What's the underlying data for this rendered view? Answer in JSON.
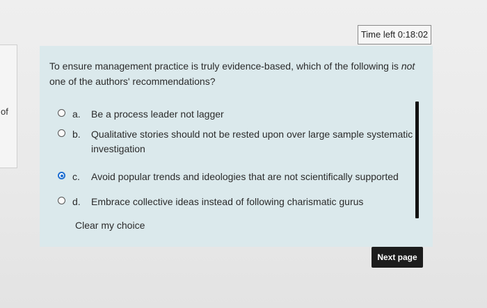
{
  "sidebar": {
    "fragment_text": "of"
  },
  "timer": {
    "label": "Time left 0:18:02"
  },
  "question": {
    "text_part1": "To ensure management practice is truly evidence-based, which of the following is ",
    "text_emphasis": "not",
    "text_part2": " one of the authors' recommendations?"
  },
  "answers": [
    {
      "letter": "a.",
      "text": "Be a process leader not lagger",
      "selected": false
    },
    {
      "letter": "b.",
      "text": "Qualitative stories should not be rested upon over large sample systematic investigation",
      "selected": false
    },
    {
      "letter": "c.",
      "text": "Avoid popular trends and ideologies that are not scientifically supported",
      "selected": true
    },
    {
      "letter": "d.",
      "text": "Embrace collective ideas instead of following charismatic gurus",
      "selected": false
    }
  ],
  "clear_choice_label": "Clear my choice",
  "next_page_label": "Next page",
  "colors": {
    "panel_bg": "#dbe9ec",
    "radio_selected": "#1f6fd1",
    "button_bg": "#1c1c1c"
  }
}
